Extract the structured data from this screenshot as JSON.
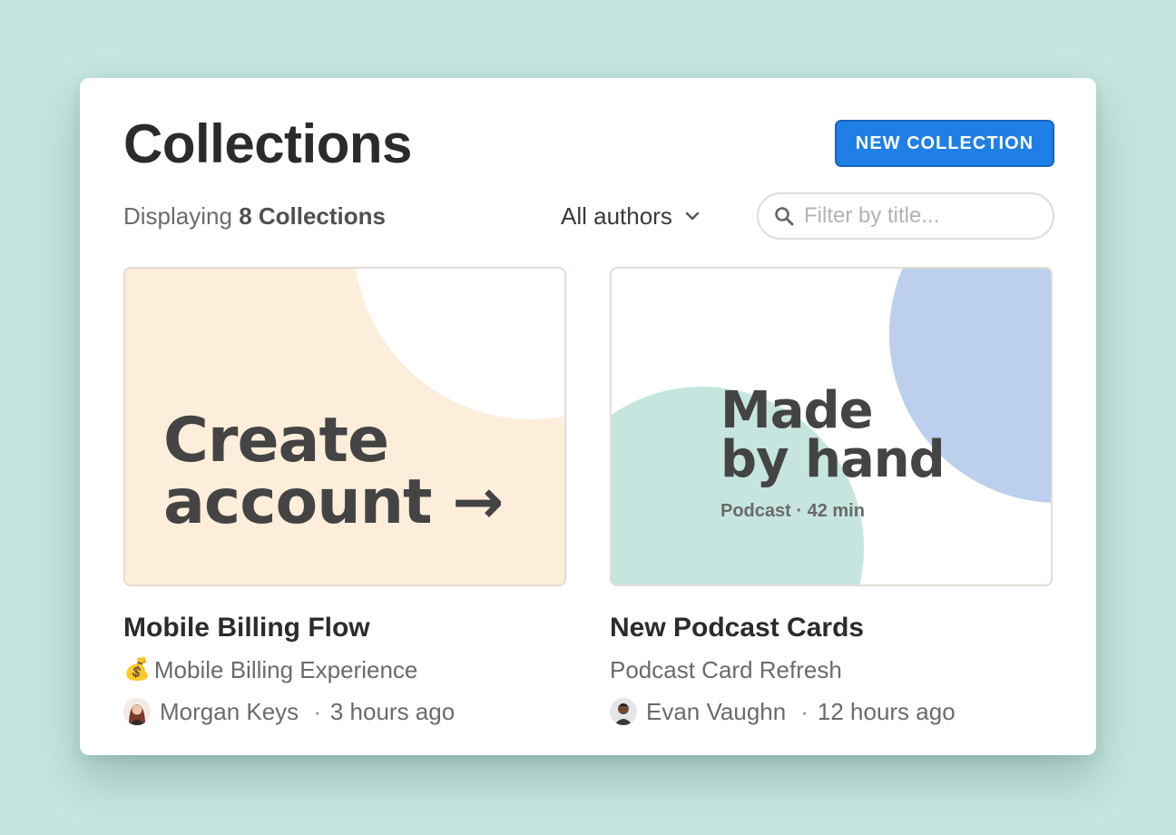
{
  "header": {
    "title": "Collections",
    "new_button_label": "NEW COLLECTION"
  },
  "toolbar": {
    "count_prefix": "Displaying",
    "count_value": "8 Collections",
    "author_filter": "All authors",
    "search_placeholder": "Filter by title..."
  },
  "collections": [
    {
      "thumbnail_text_line1": "Create",
      "thumbnail_text_line2": "account →",
      "thumbnail_bg": "#fdeedb",
      "title": "Mobile Billing Flow",
      "project_emoji": "💰",
      "project": "Mobile Billing Experience",
      "author": "Morgan Keys",
      "updated": "3 hours ago"
    },
    {
      "thumbnail_text_line1": "Made",
      "thumbnail_text_line2": "by hand",
      "thumbnail_sub": "Podcast · 42 min",
      "thumbnail_colors": [
        "#c6e5df",
        "#bccfec"
      ],
      "title": "New Podcast Cards",
      "project": "Podcast Card Refresh",
      "author": "Evan Vaughn",
      "updated": "12 hours ago"
    }
  ],
  "colors": {
    "background": "#c6e5df",
    "accent": "#1f7fe6"
  }
}
